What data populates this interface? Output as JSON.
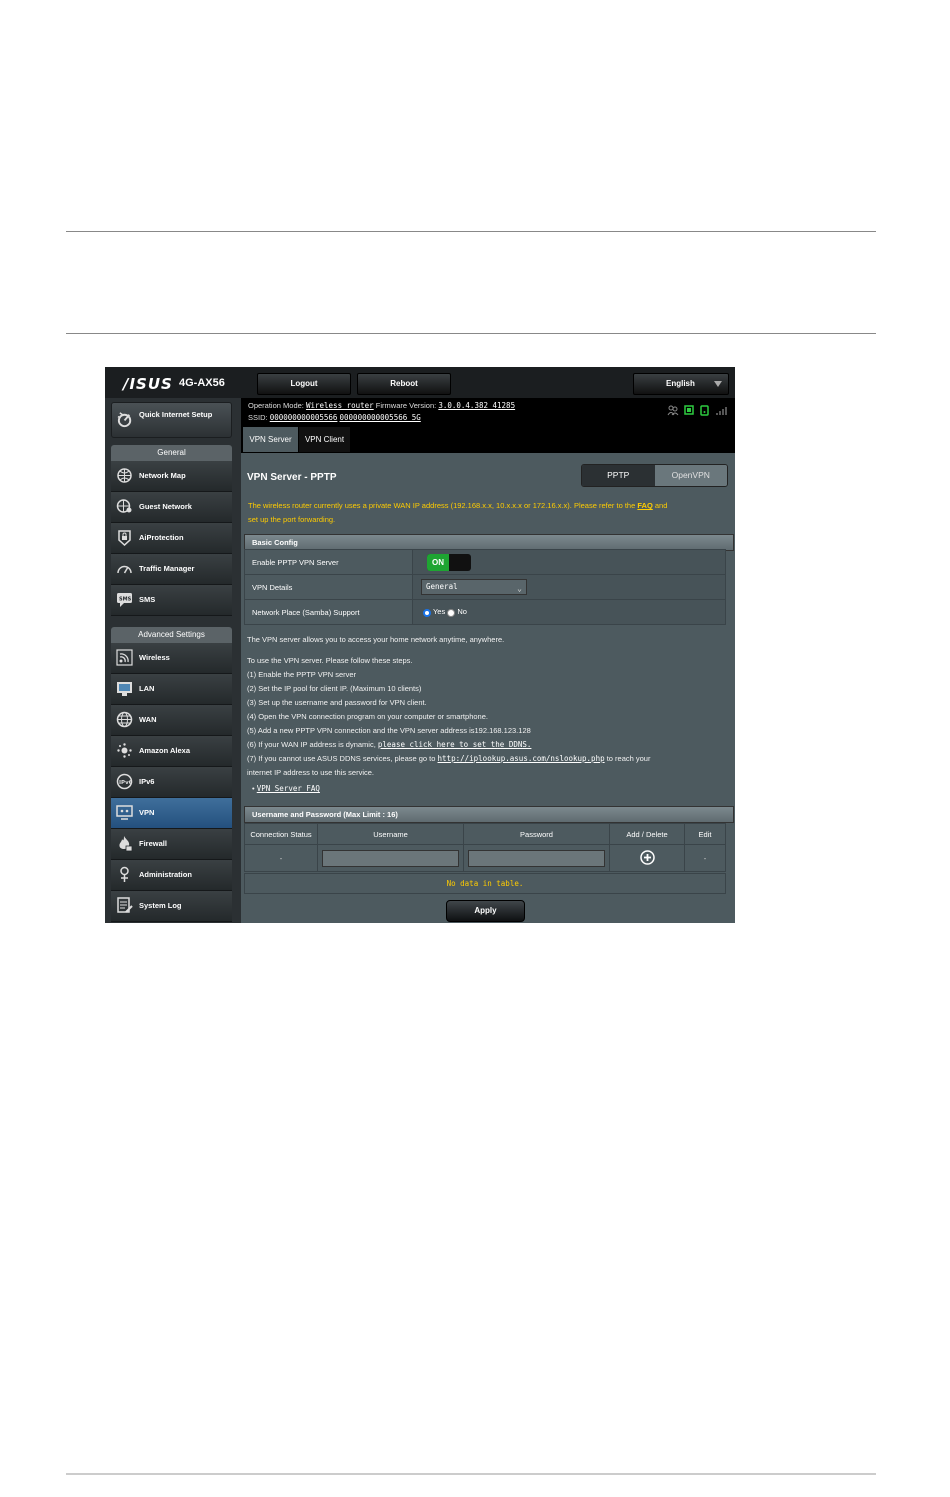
{
  "header": {
    "brand": "/ISUS",
    "model": "4G-AX56",
    "logout_label": "Logout",
    "reboot_label": "Reboot",
    "language": "English"
  },
  "info": {
    "operation_mode_label": "Operation Mode:",
    "operation_mode_value": "Wireless router",
    "firmware_label": "Firmware Version:",
    "firmware_value": "3.0.0.4.382_41285",
    "ssid_label": "SSID:",
    "ssid_1": "000000000005566",
    "ssid_2": "000000000005566_5G"
  },
  "tabs": [
    {
      "label": "VPN Server",
      "active": true
    },
    {
      "label": "VPN Client",
      "active": false
    }
  ],
  "sidebar": {
    "qis_label": "Quick Internet Setup",
    "general_header": "General",
    "general_items": [
      {
        "label": "Network Map",
        "icon": "network-map-icon"
      },
      {
        "label": "Guest Network",
        "icon": "guest-network-icon"
      },
      {
        "label": "AiProtection",
        "icon": "lock-icon"
      },
      {
        "label": "Traffic Manager",
        "icon": "speedometer-icon"
      },
      {
        "label": "SMS",
        "icon": "sms-icon"
      }
    ],
    "advanced_header": "Advanced Settings",
    "advanced_items": [
      {
        "label": "Wireless",
        "icon": "wireless-icon"
      },
      {
        "label": "LAN",
        "icon": "lan-icon"
      },
      {
        "label": "WAN",
        "icon": "globe-icon"
      },
      {
        "label": "Amazon Alexa",
        "icon": "alexa-icon"
      },
      {
        "label": "IPv6",
        "icon": "ipv6-icon"
      },
      {
        "label": "VPN",
        "icon": "vpn-icon",
        "active": true
      },
      {
        "label": "Firewall",
        "icon": "fire-icon"
      },
      {
        "label": "Administration",
        "icon": "administration-icon"
      },
      {
        "label": "System Log",
        "icon": "system-log-icon"
      }
    ]
  },
  "main": {
    "title": "VPN Server - PPTP",
    "seg_pptp": "PPTP",
    "seg_openvpn": "OpenVPN",
    "warning_text": "The wireless router currently uses a private WAN IP address (192.168.x.x, 10.x.x.x or 172.16.x.x). Please refer to the",
    "warning_faq": "FAQ",
    "warning_and": "and",
    "warning_line2": "set up the port forwarding.",
    "basic_config_header": "Basic Config",
    "rows": {
      "enable_label": "Enable PPTP VPN Server",
      "toggle_on": "ON",
      "details_label": "VPN Details",
      "details_value": "General",
      "samba_label": "Network Place (Samba) Support",
      "yes": "Yes",
      "no": "No"
    },
    "intro": "The VPN server allows you to access your home network anytime, anywhere.",
    "steps_intro": "To use the VPN server. Please follow these steps.",
    "step1": "(1) Enable the PPTP VPN server",
    "step2": "(2) Set the IP pool for client IP. (Maximum 10 clients)",
    "step3": "(3) Set up the username and password for VPN client.",
    "step4": "(4) Open the VPN connection program on your computer or smartphone.",
    "step5": "(5) Add a new PPTP VPN connection and the VPN server address is192.168.123.128",
    "step6_a": "(6) If your WAN IP address is dynamic,",
    "step6_link": "please click here to set the DDNS.",
    "step7_a": "(7) If you cannot use ASUS DDNS services, please go to",
    "step7_link": "http://iplookup.asus.com/nslookup.php",
    "step7_b": "to reach your",
    "step7_line2": "internet IP address to use this service.",
    "faq_link": "VPN Server FAQ",
    "bullet": "•",
    "users_header": "Username and Password (Max Limit : 16)",
    "columns": [
      "Connection Status",
      "Username",
      "Password",
      "Add / Delete",
      "Edit"
    ],
    "row_status": "-",
    "row_edit": "-",
    "no_data": "No data in table.",
    "apply": "Apply"
  }
}
